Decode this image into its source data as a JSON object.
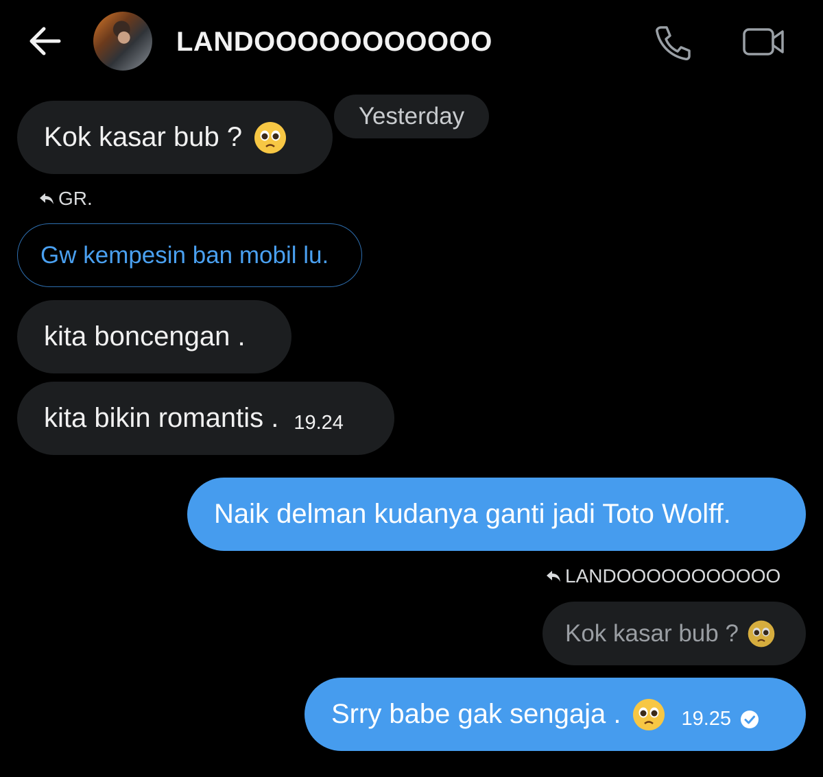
{
  "header": {
    "contact_name": "LANDOOOOOOOOOOO",
    "back_icon": "arrow-left-icon",
    "call_icon": "phone-icon",
    "video_icon": "video-camera-icon"
  },
  "date_separator": "Yesterday",
  "messages": [
    {
      "direction": "incoming",
      "text": "Kok kasar bub ?",
      "emoji": "pleading-face"
    },
    {
      "direction": "incoming",
      "reply_to_name": "GR.",
      "reply_quote": "Gw kempesin ban mobil lu."
    },
    {
      "direction": "incoming",
      "text": "kita boncengan ."
    },
    {
      "direction": "incoming",
      "text": "kita bikin romantis .",
      "time": "19.24"
    },
    {
      "direction": "outgoing",
      "text": "Naik delman kudanya ganti jadi Toto Wolff."
    },
    {
      "direction": "outgoing",
      "reply_to_name": "LANDOOOOOOOOOOO",
      "reply_quote": "Kok kasar bub ?",
      "reply_emoji": "pleading-face"
    },
    {
      "direction": "outgoing",
      "text": "Srry babe gak sengaja .",
      "emoji": "pleading-face",
      "time": "19.25",
      "status": "sent-check"
    }
  ],
  "colors": {
    "background": "#000000",
    "incoming_bubble": "#1c1e20",
    "outgoing_bubble": "#469cee",
    "quote_link": "#4aa0f0"
  }
}
